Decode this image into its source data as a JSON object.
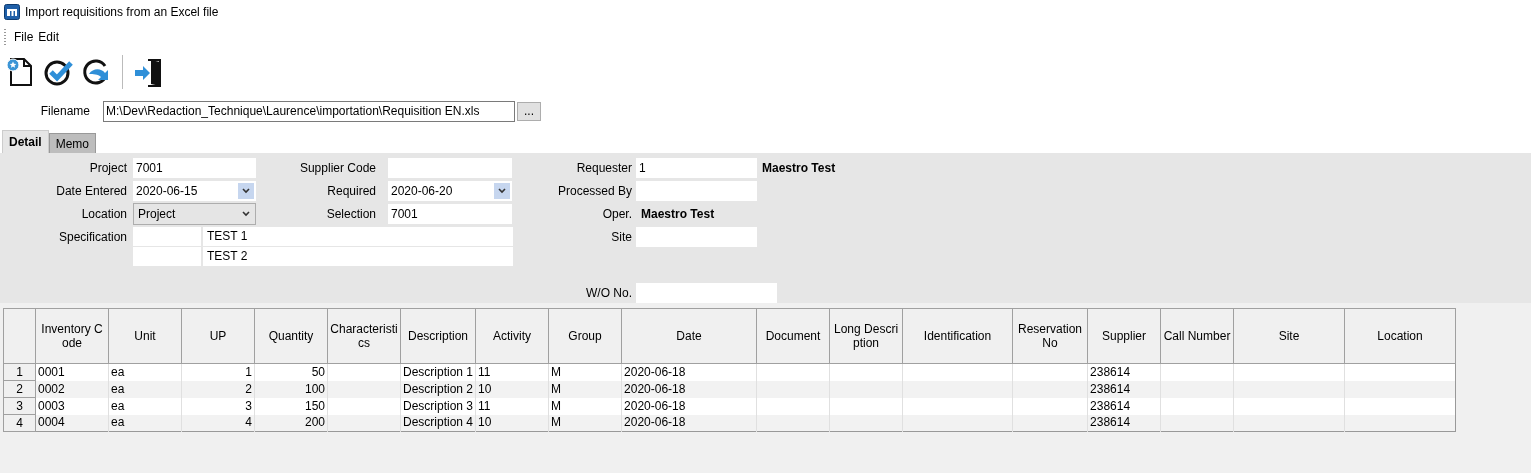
{
  "window": {
    "title": "Import requisitions from an Excel file"
  },
  "menu": [
    {
      "label": "File"
    },
    {
      "label": "Edit"
    }
  ],
  "toolbar": [
    {
      "kind": "new"
    },
    {
      "kind": "check"
    },
    {
      "kind": "refresh"
    },
    {
      "kind": "exit"
    }
  ],
  "filename": {
    "label": "Filename",
    "value": "M:\\Dev\\Redaction_Technique\\Laurence\\importation\\Requisition EN.xls",
    "browse": "..."
  },
  "tabs": [
    {
      "label": "Detail",
      "selected": true
    },
    {
      "label": "Memo",
      "selected": false
    }
  ],
  "form": {
    "project": {
      "label": "Project",
      "value": "7001"
    },
    "date_entered": {
      "label": "Date Entered",
      "value": "2020-06-15"
    },
    "location": {
      "label": "Location",
      "value": "Project"
    },
    "specification": {
      "label": "Specification",
      "lines": [
        {
          "text": "TEST 1"
        },
        {
          "text": "TEST 2"
        }
      ]
    },
    "supplier_code": {
      "label": "Supplier Code"
    },
    "required": {
      "label": "Required",
      "value": "2020-06-20"
    },
    "selection": {
      "label": "Selection",
      "value": "7001"
    },
    "requester": {
      "label": "Requester",
      "value": "1",
      "name": "Maestro Test"
    },
    "processed_by": {
      "label": "Processed By"
    },
    "operator": {
      "label": "Oper.",
      "value": "Maestro Test"
    },
    "site": {
      "label": "Site"
    },
    "wo_no": {
      "label": "W/O No."
    }
  },
  "table": {
    "columns": [
      "Inventory Code",
      "Unit",
      "UP",
      "Quantity",
      "Characteristics",
      "Description",
      "Activity",
      "Group",
      "Date",
      "Document",
      "Long Description",
      "Identification",
      "Reservation No",
      "Supplier",
      "Call Number",
      "Site",
      "Location"
    ],
    "rows": [
      {
        "number": "1",
        "cells": [
          "0001",
          "ea",
          "1",
          "50",
          null,
          "Description 1",
          "11",
          "M",
          "2020-06-18",
          null,
          null,
          null,
          null,
          "238614",
          null,
          null,
          null
        ]
      },
      {
        "number": "2",
        "cells": [
          "0002",
          "ea",
          "2",
          "100",
          null,
          "Description 2",
          "10",
          "M",
          "2020-06-18",
          null,
          null,
          null,
          null,
          "238614",
          null,
          null,
          null
        ]
      },
      {
        "number": "3",
        "cells": [
          "0003",
          "ea",
          "3",
          "150",
          null,
          "Description 3",
          "11",
          "M",
          "2020-06-18",
          null,
          null,
          null,
          null,
          "238614",
          null,
          null,
          null
        ]
      },
      {
        "number": "4",
        "cells": [
          "0004",
          "ea",
          "4",
          "200",
          null,
          "Description 4",
          "10",
          "M",
          "2020-06-18",
          null,
          null,
          null,
          null,
          "238614",
          null,
          null,
          null
        ]
      }
    ]
  }
}
